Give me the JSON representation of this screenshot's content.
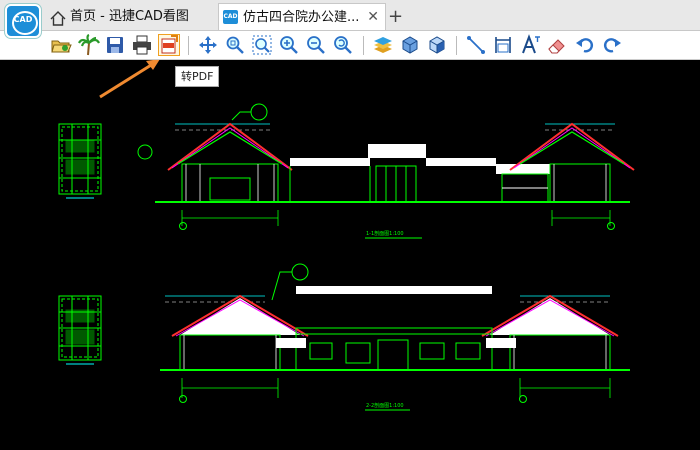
{
  "app": {
    "logo_text": "CAD"
  },
  "tabs": [
    {
      "label": "首页 - 迅捷CAD看图",
      "icon": "home-icon"
    },
    {
      "label": "仿古四合院办公建...",
      "icon": "cad-doc-icon",
      "close": "✕"
    }
  ],
  "new_tab": "+",
  "toolbar": {
    "buttons": [
      {
        "name": "open-file",
        "icon": "folder-open-icon"
      },
      {
        "name": "vip",
        "icon": "palm-tree-icon"
      },
      {
        "name": "save",
        "icon": "save-icon"
      },
      {
        "name": "print",
        "icon": "printer-icon"
      },
      {
        "name": "to-pdf",
        "icon": "pdf-export-icon"
      },
      {
        "name": "pan",
        "icon": "pan-arrows-icon"
      },
      {
        "name": "zoom-window",
        "icon": "zoom-window-icon"
      },
      {
        "name": "zoom-extents",
        "icon": "zoom-extents-icon"
      },
      {
        "name": "zoom-in",
        "icon": "zoom-in-icon"
      },
      {
        "name": "zoom-out",
        "icon": "zoom-out-icon"
      },
      {
        "name": "zoom-previous",
        "icon": "zoom-previous-icon"
      },
      {
        "name": "layers",
        "icon": "layers-icon"
      },
      {
        "name": "3d-view",
        "icon": "cube-icon"
      },
      {
        "name": "3d-shade",
        "icon": "cube-shaded-icon"
      },
      {
        "name": "measure-line",
        "icon": "line-measure-icon"
      },
      {
        "name": "dimension",
        "icon": "dimension-icon"
      },
      {
        "name": "text",
        "icon": "text-icon"
      },
      {
        "name": "eraser",
        "icon": "eraser-icon"
      },
      {
        "name": "undo",
        "icon": "undo-icon"
      },
      {
        "name": "redo",
        "icon": "redo-icon"
      }
    ],
    "tooltip": "转PDF"
  },
  "drawing": {
    "section1_label": "1-1剖面图1:100",
    "section2_label": "2-2剖面图1:100",
    "colors": {
      "line": "#00ff00",
      "wall": "#ffffff",
      "roof": "#ff3030",
      "accent": "#ff00ff",
      "dim": "#00ffff"
    }
  }
}
